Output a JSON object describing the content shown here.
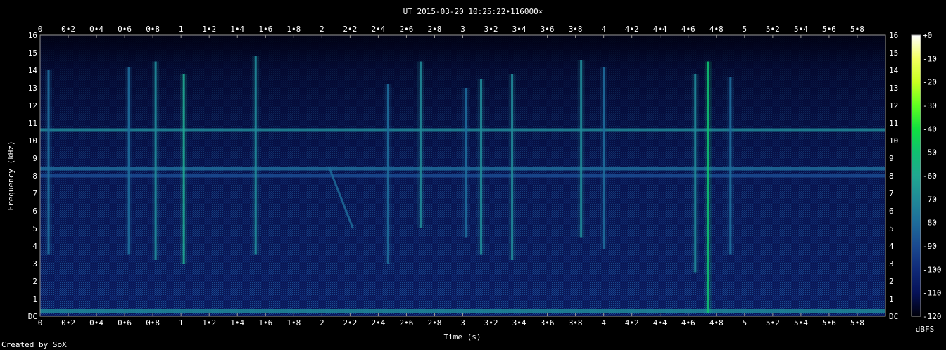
{
  "chart_data": {
    "type": "heatmap",
    "title": "UT 2015-03-20 10:25:22•116000×",
    "xlabel": "Time (s)",
    "ylabel": "Frequency (kHz)",
    "xlim": [
      0,
      6.0
    ],
    "ylim": [
      0,
      16
    ],
    "x_ticks": [
      "0",
      "0•2",
      "0•4",
      "0•6",
      "0•8",
      "1",
      "1•2",
      "1•4",
      "1•6",
      "1•8",
      "2",
      "2•2",
      "2•4",
      "2•6",
      "2•8",
      "3",
      "3•2",
      "3•4",
      "3•6",
      "3•8",
      "4",
      "4•2",
      "4•4",
      "4•6",
      "4•8",
      "5",
      "5•2",
      "5•4",
      "5•6",
      "5•8"
    ],
    "y_ticks": [
      "DC",
      "1",
      "2",
      "3",
      "4",
      "5",
      "6",
      "7",
      "8",
      "9",
      "10",
      "11",
      "12",
      "13",
      "14",
      "15",
      "16"
    ],
    "colorbar": {
      "label": "dBFS",
      "ticks": [
        "+0",
        "-10",
        "-20",
        "-30",
        "-40",
        "-50",
        "-60",
        "-70",
        "-80",
        "-90",
        "-100",
        "-110",
        "-120"
      ],
      "colors": [
        "#ffffff",
        "#f4ff60",
        "#c8ff20",
        "#60ff20",
        "#10e040",
        "#10c070",
        "#20a890",
        "#208a98",
        "#1e6c9a",
        "#1a4a90",
        "#102a78",
        "#061258",
        "#00000a"
      ]
    },
    "horizontal_bands": [
      {
        "freq_khz": 10.6,
        "level_dbfs": -70
      },
      {
        "freq_khz": 8.4,
        "level_dbfs": -85
      },
      {
        "freq_khz": 8.0,
        "level_dbfs": -88
      },
      {
        "freq_khz": 0.3,
        "level_dbfs": -75
      }
    ],
    "impulses": [
      {
        "t": 0.06,
        "f_low": 3.5,
        "f_high": 14.0,
        "level_dbfs": -80
      },
      {
        "t": 0.63,
        "f_low": 3.5,
        "f_high": 14.2,
        "level_dbfs": -78
      },
      {
        "t": 0.82,
        "f_low": 3.2,
        "f_high": 14.5,
        "level_dbfs": -72
      },
      {
        "t": 1.02,
        "f_low": 3.0,
        "f_high": 13.8,
        "level_dbfs": -65
      },
      {
        "t": 1.53,
        "f_low": 3.5,
        "f_high": 14.8,
        "level_dbfs": -75
      },
      {
        "t": 2.47,
        "f_low": 3.0,
        "f_high": 13.2,
        "level_dbfs": -80
      },
      {
        "t": 2.7,
        "f_low": 5.0,
        "f_high": 14.5,
        "level_dbfs": -72
      },
      {
        "t": 3.02,
        "f_low": 4.5,
        "f_high": 13.0,
        "level_dbfs": -78
      },
      {
        "t": 3.13,
        "f_low": 3.5,
        "f_high": 13.5,
        "level_dbfs": -75
      },
      {
        "t": 3.35,
        "f_low": 3.2,
        "f_high": 13.8,
        "level_dbfs": -72
      },
      {
        "t": 3.84,
        "f_low": 4.5,
        "f_high": 14.6,
        "level_dbfs": -74
      },
      {
        "t": 4.0,
        "f_low": 3.8,
        "f_high": 14.2,
        "level_dbfs": -76
      },
      {
        "t": 4.65,
        "f_low": 2.5,
        "f_high": 13.8,
        "level_dbfs": -70
      },
      {
        "t": 4.74,
        "f_low": 0.2,
        "f_high": 14.5,
        "level_dbfs": -55
      },
      {
        "t": 4.9,
        "f_low": 3.5,
        "f_high": 13.6,
        "level_dbfs": -80
      }
    ],
    "sweep": {
      "t_start": 2.05,
      "f_start": 8.5,
      "t_end": 2.22,
      "f_end": 5.0,
      "level_dbfs": -82
    }
  },
  "footer": {
    "credit": "Created by SoX"
  }
}
